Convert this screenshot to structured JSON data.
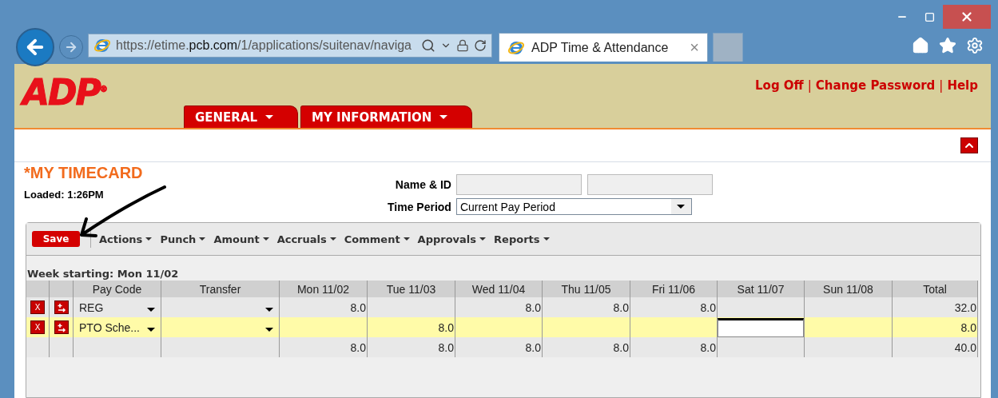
{
  "browser": {
    "address": {
      "scheme": "https",
      "host_prefix": "://etime.",
      "host": "pcb.com",
      "path": "/1/applications/suitenav/naviga"
    },
    "tab": {
      "title": "ADP Time & Attendance",
      "close": "×"
    }
  },
  "header": {
    "logo": {
      "text": "ADP",
      "mark": "®"
    },
    "links": [
      "Log Off",
      "Change Password",
      "Help"
    ],
    "separator": "|",
    "menus": [
      {
        "label": "GENERAL"
      },
      {
        "label": "MY INFORMATION"
      }
    ]
  },
  "timecard": {
    "title": "*MY TIMECARD",
    "loaded": "Loaded: 1:26PM",
    "fields": [
      {
        "kind": "pair",
        "label": "Name & ID"
      },
      {
        "kind": "select",
        "label": "Time Period",
        "value": "Current Pay Period"
      }
    ],
    "save": "Save",
    "toolbar": [
      "Actions",
      "Punch",
      "Amount",
      "Accruals",
      "Comment",
      "Approvals",
      "Reports"
    ],
    "week": "Week starting: Mon 11/02",
    "columns": [
      "Pay Code",
      "Transfer",
      "Mon 11/02",
      "Tue 11/03",
      "Wed 11/04",
      "Thu 11/05",
      "Fri 11/06",
      "Sat 11/07",
      "Sun 11/08",
      "Total"
    ],
    "rows": [
      {
        "kind": "entry",
        "selected": false,
        "delete": "X",
        "pay_code": "REG",
        "days": [
          {
            "value": "8.0",
            "focused": false
          },
          {
            "focused": false
          },
          {
            "value": "8.0",
            "focused": false
          },
          {
            "value": "8.0",
            "focused": false
          },
          {
            "value": "8.0",
            "focused": false
          },
          {
            "focused": false
          },
          {
            "focused": false
          }
        ],
        "total": "32.0"
      },
      {
        "kind": "entry",
        "selected": true,
        "delete": "X",
        "pay_code": "PTO Sche...",
        "days": [
          {
            "focused": false
          },
          {
            "value": "8.0",
            "focused": false
          },
          {
            "focused": false
          },
          {
            "focused": false
          },
          {
            "focused": false
          },
          {
            "focused": true
          },
          {
            "focused": false
          }
        ],
        "total": "8.0"
      },
      {
        "kind": "total",
        "selected": false,
        "days": [
          {
            "value": "8.0",
            "focused": false
          },
          {
            "value": "8.0",
            "focused": false
          },
          {
            "value": "8.0",
            "focused": false
          },
          {
            "value": "8.0",
            "focused": false
          },
          {
            "value": "8.0",
            "focused": false
          },
          {
            "focused": false
          },
          {
            "focused": false
          }
        ],
        "total": "40.0"
      }
    ]
  }
}
